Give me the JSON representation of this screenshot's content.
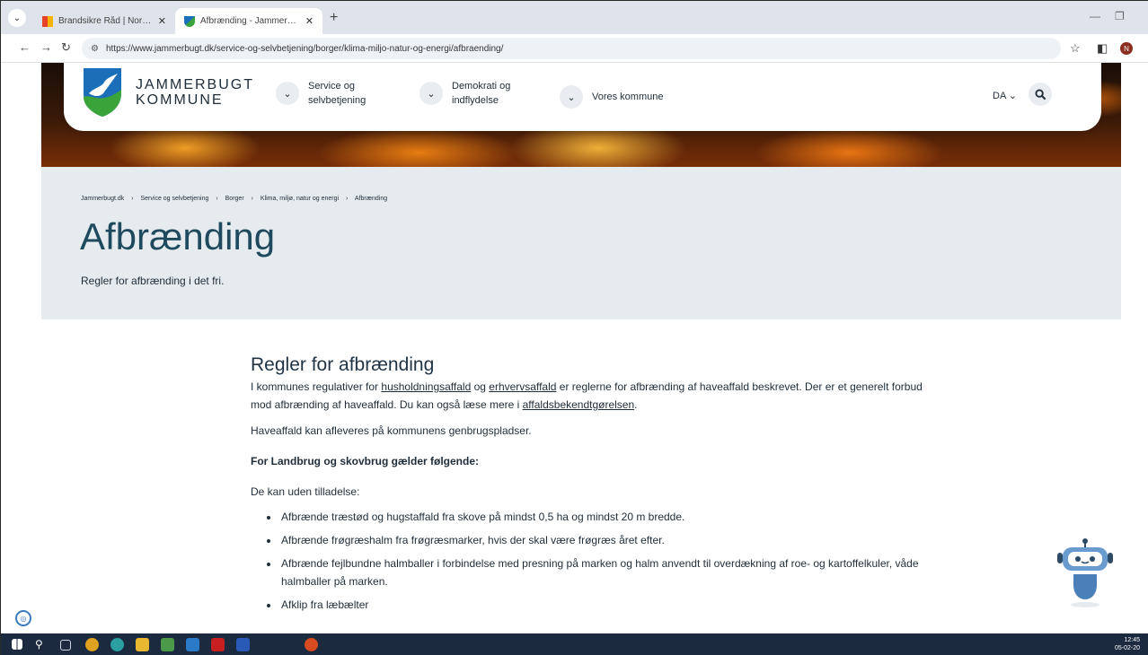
{
  "browser": {
    "tabs": [
      {
        "label": "Brandsikre Råd | Nordjyllands B",
        "active": false
      },
      {
        "label": "Afbrænding - Jammerbugt Kom",
        "active": true
      }
    ],
    "url": "https://www.jammerbugt.dk/service-og-selvbetjening/borger/klima-miljo-natur-og-energi/afbraending/",
    "profile_initial": "N"
  },
  "site": {
    "logo_line1": "JAMMERBUGT",
    "logo_line2": "KOMMUNE",
    "nav": [
      {
        "label": "Service og selvbetjening"
      },
      {
        "label": "Demokrati og indflydelse"
      },
      {
        "label": "Vores kommune"
      }
    ],
    "lang": "DA"
  },
  "breadcrumb": [
    "Jammerbugt.dk",
    "Service og selvbetjening",
    "Borger",
    "Klima, miljø, natur og energi",
    "Afbrænding"
  ],
  "page": {
    "title": "Afbrænding",
    "lead": "Regler for afbrænding i det fri."
  },
  "article": {
    "heading": "Regler for afbrænding",
    "p1_a": "I kommunes regulativer for ",
    "link1": "husholdningsaffald",
    "p1_b": " og ",
    "link2": "erhvervsaffald",
    "p1_c": " er reglerne for afbrænding af haveaffald beskrevet. Der er et generelt forbud mod afbrænding af haveaffald. Du kan også læse mere i ",
    "link3": "affaldsbekendtgørelsen",
    "p1_d": ".",
    "p2": "Haveaffald kan afleveres på kommunens genbrugspladser.",
    "p3": "For Landbrug og skovbrug gælder følgende:",
    "p4": "De kan uden tilladelse:",
    "bullets": [
      "Afbrænde træstød og hugstaffald  fra skove på mindst 0,5 ha og mindst 20 m bredde.",
      "Afbrænde frøgræshalm fra frøgræsmarker, hvis der skal være frøgræs året efter.",
      "Afbrænde fejlbundne halmballer i forbindelse med presning på marken og halm anvendt til overdækning af roe- og kartoffelkuler, våde halmballer på marken.",
      "Afklip fra læbælter"
    ]
  },
  "taskbar": {
    "time": "12:45",
    "date": "05-02-20"
  }
}
